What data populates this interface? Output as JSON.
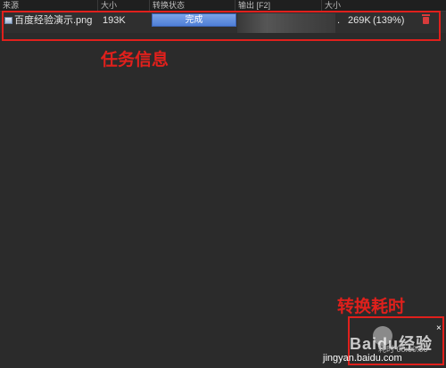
{
  "columns": [
    "来源",
    "大小",
    "转换状态",
    "输出 [F2]",
    "大小"
  ],
  "task": {
    "filename": "百度经验演示.png",
    "source_size": "193K",
    "status": "完成",
    "progress": 1.0,
    "output_path_visible": ".",
    "output_size": "269K",
    "ratio": "(139%)"
  },
  "annotations": {
    "task_info": "任务信息",
    "conversion_time": "转换耗时"
  },
  "footer": {
    "close_label": "×",
    "elapsed_time": "耗时 00:00:00"
  },
  "watermark": {
    "title": "Baidu经验",
    "url": "jingyan.baidu.com"
  },
  "colors": {
    "annotation_red": "#e0201c",
    "progress_blue": "#5a86dc",
    "background": "#2b2b2b"
  }
}
